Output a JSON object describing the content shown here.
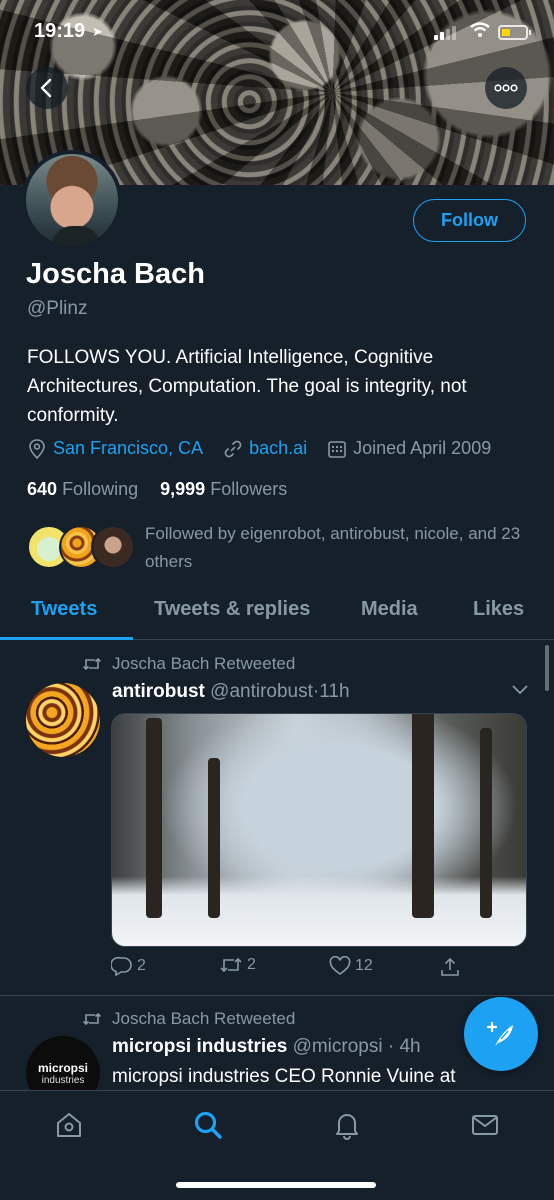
{
  "status_bar": {
    "time": "19:19"
  },
  "profile": {
    "name": "Joscha Bach",
    "handle": "@Plinz",
    "follow_label": "Follow",
    "bio": "FOLLOWS YOU. Artificial Intelligence, Cognitive Architectures, Computation. The goal is integrity, not conformity.",
    "location": "San Francisco, CA",
    "website": "bach.ai",
    "joined": "Joined April 2009",
    "following_count": "640",
    "following_label": "Following",
    "followers_count": "9,999",
    "followers_label": "Followers",
    "followed_by": "Followed by eigenrobot, antirobust, nicole, and 23 others"
  },
  "tabs": [
    {
      "label": "Tweets",
      "active": true
    },
    {
      "label": "Tweets & replies",
      "active": false
    },
    {
      "label": "Media",
      "active": false
    },
    {
      "label": "Likes",
      "active": false
    }
  ],
  "tweets": [
    {
      "retweet_line": "Joscha Bach Retweeted",
      "name": "antirobust",
      "handle": "@antirobust",
      "sep": "·",
      "time": "11h",
      "replies": "2",
      "retweets": "2",
      "likes": "12"
    },
    {
      "retweet_line": "Joscha Bach Retweeted",
      "name": "micropsi industries",
      "handle": "@micropsi",
      "sep": "·",
      "time": "4h",
      "text": "micropsi industries CEO Ronnie Vuine at",
      "avatar_line1": "micropsi",
      "avatar_line2": "industries"
    }
  ],
  "colors": {
    "accent": "#1da1f2",
    "background": "#15202b",
    "muted": "#8899a6",
    "divider": "#38444d"
  },
  "icons": [
    "back-arrow-icon",
    "more-icon",
    "location-pin-icon",
    "link-icon",
    "calendar-icon",
    "retweet-icon",
    "reply-icon",
    "like-icon",
    "share-icon",
    "chevron-down-icon",
    "compose-icon",
    "home-icon",
    "search-icon",
    "notifications-icon",
    "messages-icon"
  ]
}
